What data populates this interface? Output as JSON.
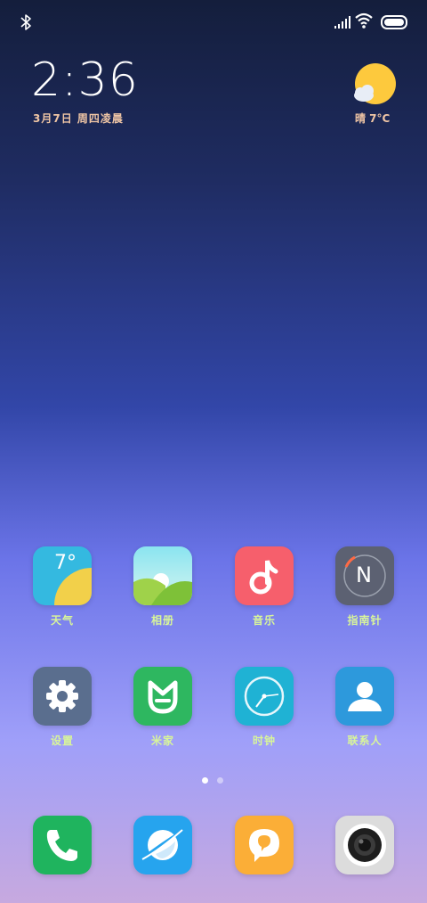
{
  "status_bar": {
    "icons": [
      "bluetooth-icon",
      "signal-icon",
      "wifi-icon",
      "battery-icon"
    ]
  },
  "clock": {
    "time": "2:36",
    "date": "3月7日 周四凌晨"
  },
  "weather": {
    "icon": "sun-cloud-icon",
    "text": "晴 7°C"
  },
  "apps_row1": [
    {
      "label": "天气",
      "icon": "weather-app-icon",
      "icon_text": "7°"
    },
    {
      "label": "相册",
      "icon": "gallery-app-icon"
    },
    {
      "label": "音乐",
      "icon": "music-app-icon"
    },
    {
      "label": "指南针",
      "icon": "compass-app-icon",
      "icon_text": "N"
    }
  ],
  "apps_row2": [
    {
      "label": "设置",
      "icon": "settings-app-icon"
    },
    {
      "label": "米家",
      "icon": "mihome-app-icon"
    },
    {
      "label": "时钟",
      "icon": "clock-app-icon"
    },
    {
      "label": "联系人",
      "icon": "contacts-app-icon"
    }
  ],
  "dock": [
    {
      "icon": "phone-app-icon"
    },
    {
      "icon": "browser-app-icon"
    },
    {
      "icon": "messages-app-icon"
    },
    {
      "icon": "camera-app-icon"
    }
  ],
  "page_indicator": {
    "pages": 2,
    "current": 1
  },
  "colors": {
    "label": "#d8f59a",
    "widget_text": "#f0c6a5"
  }
}
